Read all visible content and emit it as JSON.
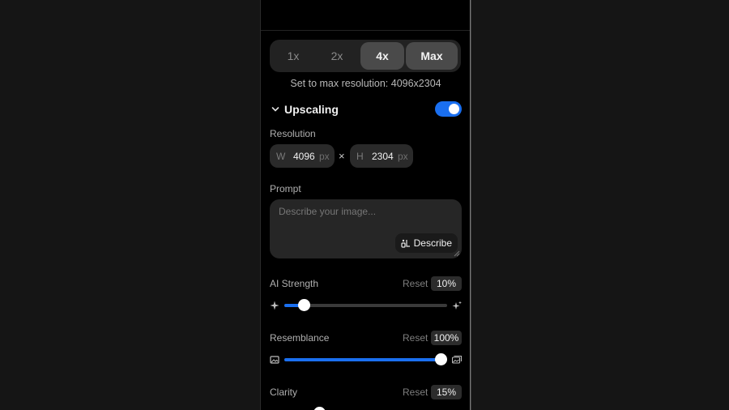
{
  "scale": {
    "options": [
      {
        "label": "1x",
        "active": false
      },
      {
        "label": "2x",
        "active": false
      },
      {
        "label": "4x",
        "active": true
      },
      {
        "label": "Max",
        "active": true
      }
    ],
    "note": "Set to max resolution: 4096x2304"
  },
  "upscaling": {
    "title": "Upscaling",
    "enabled": true
  },
  "resolution": {
    "label": "Resolution",
    "width": {
      "prefix": "W",
      "value": "4096",
      "unit": "px"
    },
    "separator": "×",
    "height": {
      "prefix": "H",
      "value": "2304",
      "unit": "px"
    }
  },
  "prompt": {
    "label": "Prompt",
    "placeholder": "Describe your image...",
    "describe_label": "Describe"
  },
  "ai_strength": {
    "label": "AI Strength",
    "reset": "Reset",
    "value": "10%",
    "level": 0.12
  },
  "resemblance": {
    "label": "Resemblance",
    "reset": "Reset",
    "value": "100%",
    "level": 0.96
  },
  "clarity": {
    "label": "Clarity",
    "reset": "Reset",
    "value": "15%"
  },
  "colors": {
    "accent": "#1a6ff0",
    "panel_bg": "#000000",
    "page_bg": "#151515"
  }
}
